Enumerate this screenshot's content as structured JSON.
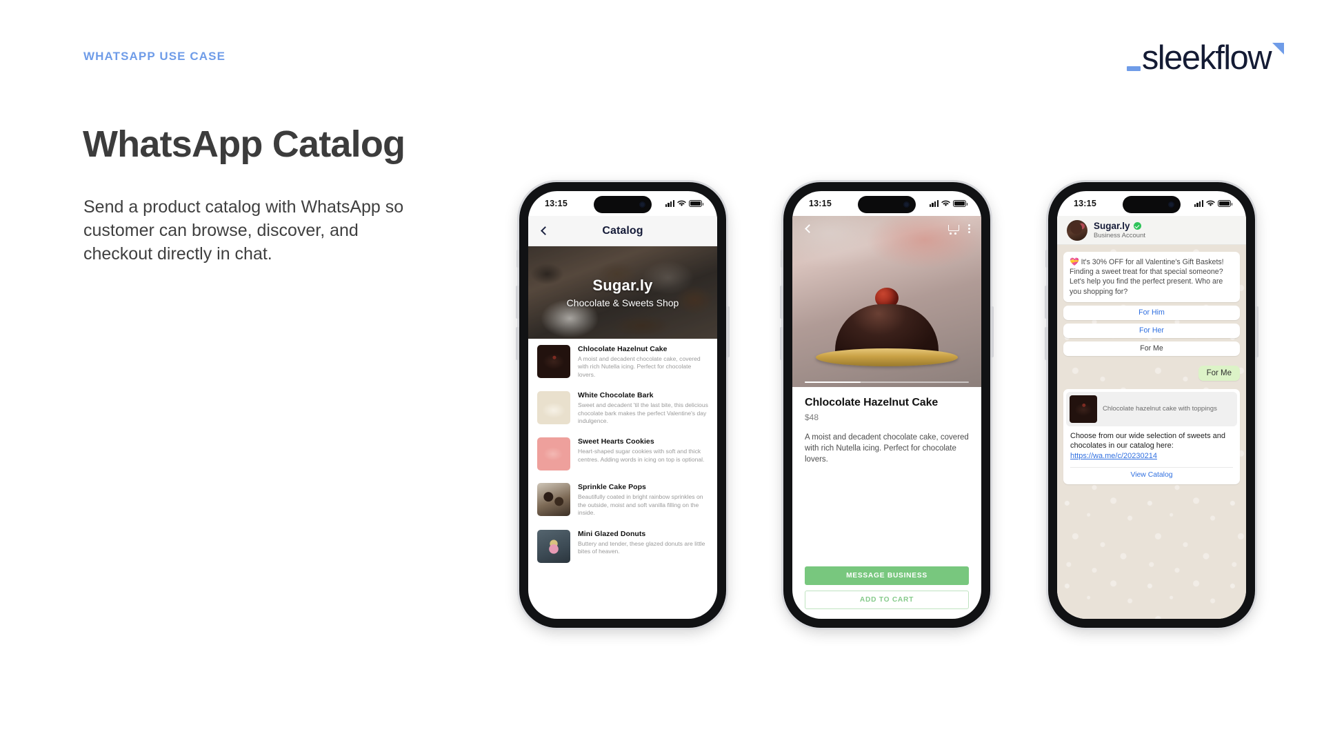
{
  "header": {
    "eyebrow": "WHATSAPP USE CASE",
    "logo": {
      "underscore": "_",
      "word": "sleekflow"
    }
  },
  "hero": {
    "title": "WhatsApp Catalog",
    "subtitle": "Send a product catalog with WhatsApp so customer can browse, discover, and checkout directly in chat."
  },
  "colors": {
    "accent_blue": "#6f9ce8",
    "link_blue": "#2f6fe0",
    "whatsapp_green": "#78c77e",
    "outgoing_bubble": "#dcf3c7",
    "verified_green": "#2fc35a",
    "heading_dark": "#3c3c3c"
  },
  "status_bar": {
    "time": "13:15",
    "icons": [
      "cellular-signal-icon",
      "wifi-icon",
      "battery-icon"
    ]
  },
  "phone1": {
    "nav": {
      "back": "back-chevron-icon",
      "title": "Catalog"
    },
    "banner": {
      "shop_name": "Sugar.ly",
      "shop_tagline": "Chocolate & Sweets Shop"
    },
    "products": [
      {
        "name": "Chlocolate Hazelnut Cake",
        "desc": "A moist and decadent chocolate cake, covered with rich Nutella icing. Perfect for chocolate lovers.",
        "thumb": "t-cake"
      },
      {
        "name": "White Chocolate Bark",
        "desc": "Sweet and decadent 'til the last bite, this delicious chocolate bark makes the perfect Valentine's day indulgence.",
        "thumb": "t-bark"
      },
      {
        "name": "Sweet Hearts Cookies",
        "desc": "Heart-shaped sugar cookies with soft and thick centres. Adding words in icing on top is optional.",
        "thumb": "t-cook"
      },
      {
        "name": "Sprinkle Cake Pops",
        "desc": "Beautifully coated in bright rainbow sprinkles on the outside, moist and soft vanilla filling on the inside.",
        "thumb": "t-pops"
      },
      {
        "name": "Mini Glazed Donuts",
        "desc": "Buttery and tender, these glazed donuts are little bites of heaven.",
        "thumb": "t-donut"
      }
    ]
  },
  "phone2": {
    "topbar": {
      "back": "back-chevron-icon",
      "cart": "shopping-cart-icon",
      "menu": "kebab-menu-icon"
    },
    "product": {
      "name": "Chlocolate Hazelnut Cake",
      "price": "$48",
      "desc": "A moist and decadent chocolate cake, covered with rich Nutella icing. Perfect for chocolate lovers."
    },
    "actions": {
      "primary": "MESSAGE BUSINESS",
      "secondary": "ADD TO CART"
    }
  },
  "phone3": {
    "chat_header": {
      "name": "Sugar.ly",
      "subtitle": "Business Account",
      "badge": "verified-badge-icon"
    },
    "incoming_message": "It's 30% OFF for all Valentine's Gift Baskets! Finding a sweet treat for that special someone? Let's help you find the perfect present. Who are you shopping for?",
    "incoming_emoji": "💝",
    "reply_buttons": [
      {
        "label": "For Him",
        "style": "blue"
      },
      {
        "label": "For Her",
        "style": "blue"
      },
      {
        "label": "For Me",
        "style": "dark"
      }
    ],
    "outgoing_message": "For Me",
    "catalog_card": {
      "preview_caption": "Chlocolate hazelnut cake with toppings",
      "text": "Choose from our wide selection of sweets and chocolates in our catalog here:",
      "link": "https://wa.me/c/20230214",
      "action": "View Catalog"
    }
  }
}
